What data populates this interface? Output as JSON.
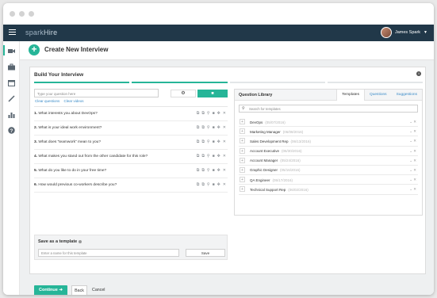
{
  "topbar": {
    "brand_light": "spark",
    "brand_bold": "Hire",
    "user_name": "James Spark",
    "caret": "▼"
  },
  "page": {
    "title": "Create New Interview"
  },
  "card": {
    "title": "Build Your Interview"
  },
  "question_input": {
    "placeholder": "Type your question here",
    "clear_questions": "Clear questions",
    "clear_videos": "Clear videos"
  },
  "questions": [
    {
      "num": "1.",
      "text": "What interests you about DevOps?"
    },
    {
      "num": "2.",
      "text": "What is your ideal work environment?"
    },
    {
      "num": "3.",
      "text": "What does “teamwork” mean to you?"
    },
    {
      "num": "4.",
      "text": "What makes you stand out from the other candidate for this role?"
    },
    {
      "num": "5.",
      "text": "What do you like to do in your free time?"
    },
    {
      "num": "6.",
      "text": "How would previous co-workers describe you?"
    }
  ],
  "save_template": {
    "title": "Save as a template",
    "placeholder": "Enter a name for this template",
    "save_label": "Save"
  },
  "library": {
    "title": "Question Library",
    "tabs": [
      "Templates",
      "Questions",
      "Suggestions"
    ],
    "search_placeholder": "Search for templates",
    "templates": [
      {
        "name": "DevOps",
        "date": "(05/07/2016)"
      },
      {
        "name": "Marketing Manager",
        "date": "(06/08/2016)"
      },
      {
        "name": "Sales Development Rep",
        "date": "(06/13/2016)"
      },
      {
        "name": "Account Executive",
        "date": "(06/30/2016)"
      },
      {
        "name": "Account Manager",
        "date": "(05/24/2016)"
      },
      {
        "name": "Graphic Designer",
        "date": "(05/16/2016)"
      },
      {
        "name": "QA Engineer",
        "date": "(05/17/2016)"
      },
      {
        "name": "Technical Support Rep",
        "date": "(06/02/2016)"
      }
    ]
  },
  "actions": {
    "continue": "Continue",
    "back": "Back",
    "cancel": "Cancel"
  },
  "colors": {
    "accent": "#26b598",
    "topbar": "#213849",
    "link": "#3a8bc8"
  }
}
